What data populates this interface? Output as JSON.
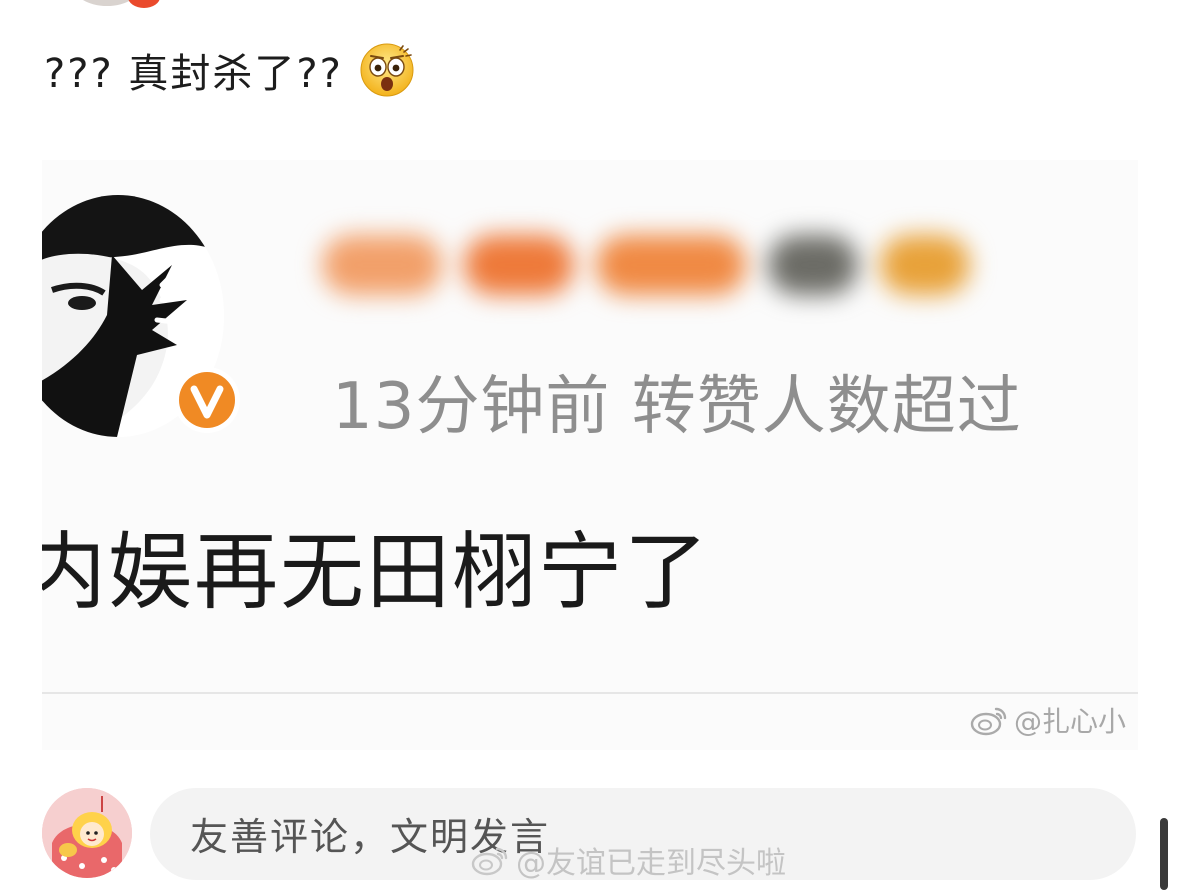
{
  "post": {
    "text": "??? 真封杀了??",
    "emoji": "surprised-face-emoji"
  },
  "embedded_card": {
    "name_blurred": true,
    "meta": "13分钟前 转赞人数超过",
    "headline": "内娱再无田栩宁了",
    "verified_badge": "V",
    "watermark": "@扎心小"
  },
  "comment_bar": {
    "placeholder": "友善评论，文明发言",
    "watermark": "@友谊已走到尽头啦"
  },
  "colors": {
    "verified_orange": "#f08a24",
    "meta_gray": "#8e8e8e",
    "input_bg": "#f3f3f3"
  }
}
